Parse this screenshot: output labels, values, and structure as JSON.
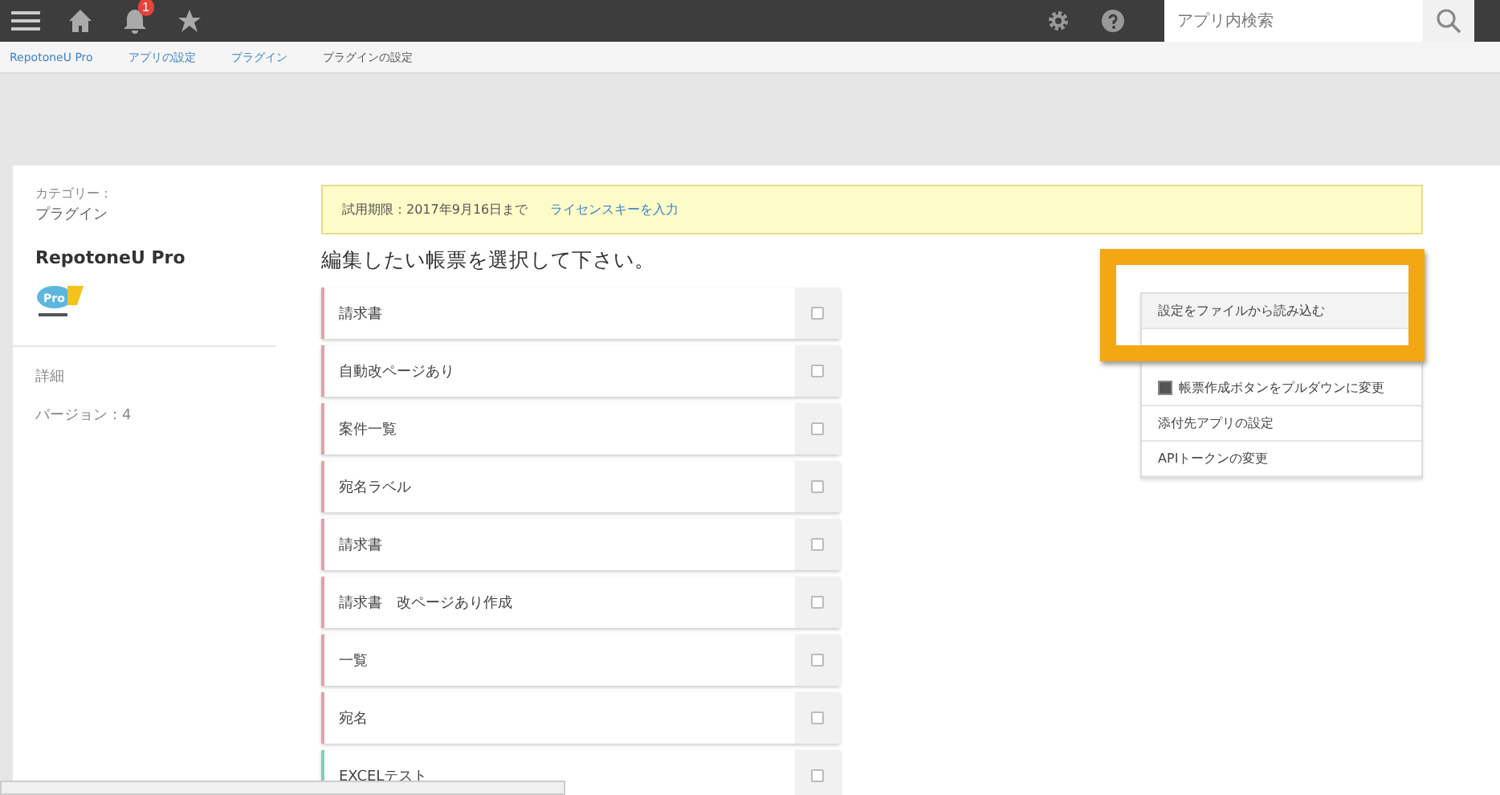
{
  "topbar": {
    "notification_count": "1",
    "search": {
      "placeholder": "アプリ内検索"
    }
  },
  "breadcrumbs": [
    "RepotoneU Pro",
    "アプリの設定",
    "プラグイン",
    "プラグインの設定"
  ],
  "sidebar": {
    "category_label": "カテゴリー：",
    "category": "プラグイン",
    "plugin_name": "RepotoneU Pro",
    "logo_text": "Pro",
    "links": [
      "詳細",
      "バージョン：4"
    ]
  },
  "notice": {
    "text": "試用期限：2017年9月16日まで",
    "link": "ライセンスキーを入力"
  },
  "heading": "編集したい帳票を選択して下さい。",
  "forms": [
    {
      "name": "請求書",
      "color": "#e8a0a0",
      "checked": false
    },
    {
      "name": "自動改ページあり",
      "color": "#e8a0a0",
      "checked": false
    },
    {
      "name": "案件一覧",
      "color": "#e8a0a0",
      "checked": false
    },
    {
      "name": "宛名ラベル",
      "color": "#e8a0a0",
      "checked": false
    },
    {
      "name": "請求書",
      "color": "#e8a0a0",
      "checked": false
    },
    {
      "name": "請求書　改ページあり作成",
      "color": "#e8a0a0",
      "checked": false
    },
    {
      "name": "一覧",
      "color": "#e8a0a0",
      "checked": false
    },
    {
      "name": "宛名",
      "color": "#e8a0a0",
      "checked": false
    },
    {
      "name": "EXCELテスト",
      "color": "#7fd0b8",
      "checked": false
    }
  ],
  "menu": [
    {
      "kind": "action",
      "label": "設定をファイルから読み込む",
      "highlighted": true
    },
    {
      "kind": "check",
      "label": "帳票作成ボタンをプルダウンに変更",
      "checked": true,
      "highlighted": false
    },
    {
      "kind": "action",
      "label": "添付先アプリの設定",
      "highlighted": false
    },
    {
      "kind": "action",
      "label": "APIトークンの変更",
      "highlighted": false
    }
  ]
}
